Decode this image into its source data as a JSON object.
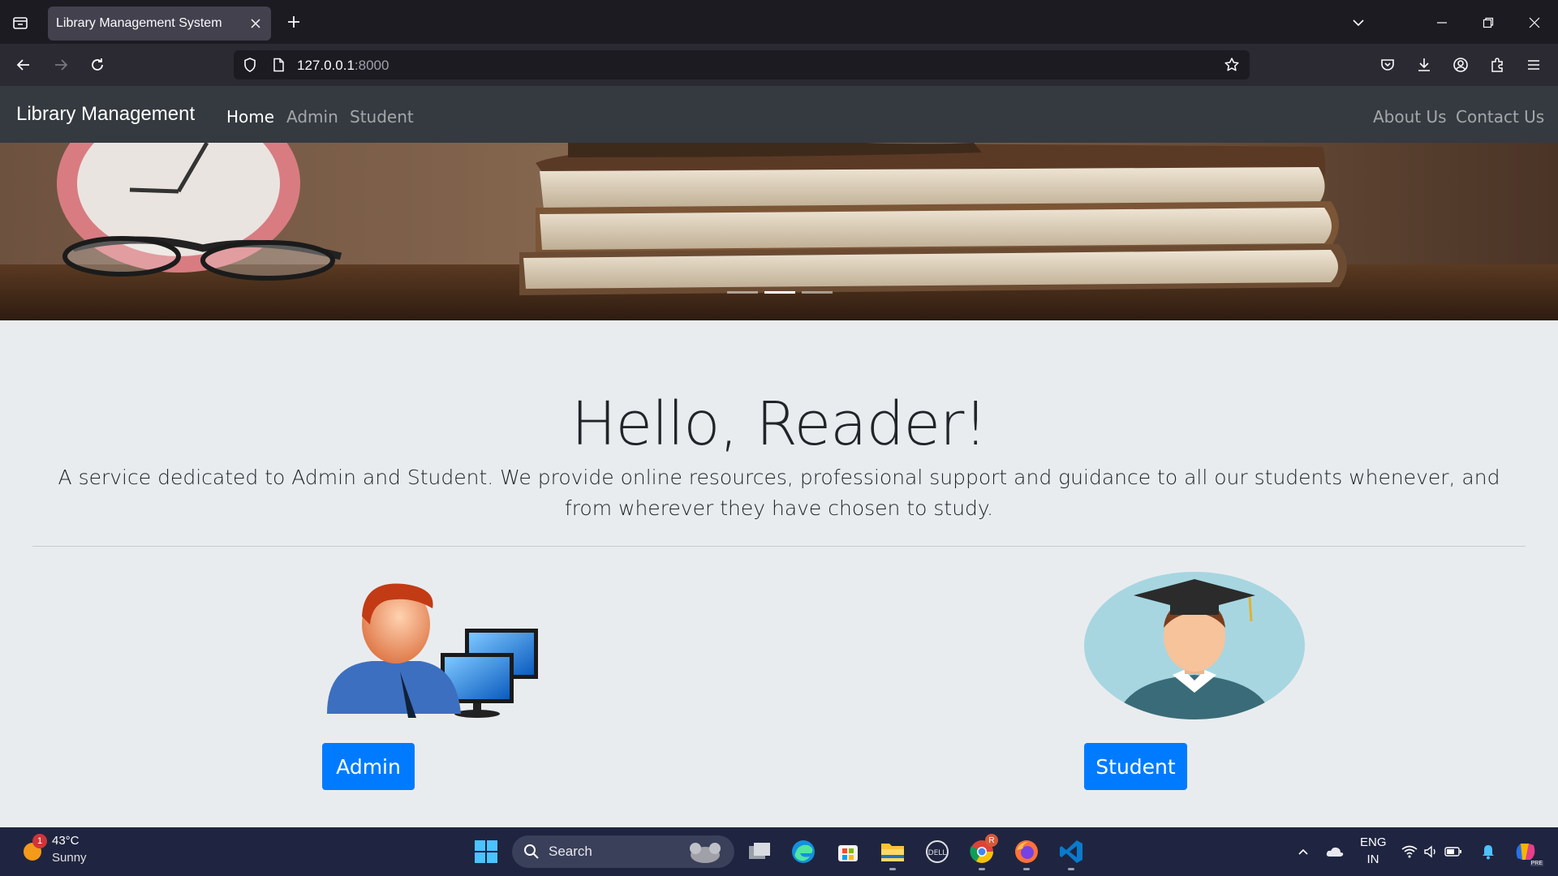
{
  "browser": {
    "tab_title": "Library Management System",
    "url_host": "127.0.0.1",
    "url_port": ":8000"
  },
  "site": {
    "brand": "Library Management",
    "nav_left": [
      "Home",
      "Admin",
      "Student"
    ],
    "nav_active": "Home",
    "nav_right": [
      "About Us",
      "Contact Us"
    ]
  },
  "carousel": {
    "slides": 3,
    "active_slide": 2
  },
  "hero": {
    "heading": "Hello, Reader!",
    "lead": "A service dedicated to Admin and Student. We provide online resources, professional support and guidance to all our students whenever, and from wherever they have chosen to study."
  },
  "cards": {
    "admin_button": "Admin",
    "student_button": "Student"
  },
  "taskbar": {
    "weather_badge": "1",
    "temperature": "43°C",
    "condition": "Sunny",
    "search_label": "Search",
    "lang_line1": "ENG",
    "lang_line2": "IN",
    "chrome_badge": "R",
    "copilot_badge": "PRE"
  },
  "colors": {
    "primary": "#007bff",
    "navbar": "#343a40",
    "page_bg": "#e9ecef"
  }
}
